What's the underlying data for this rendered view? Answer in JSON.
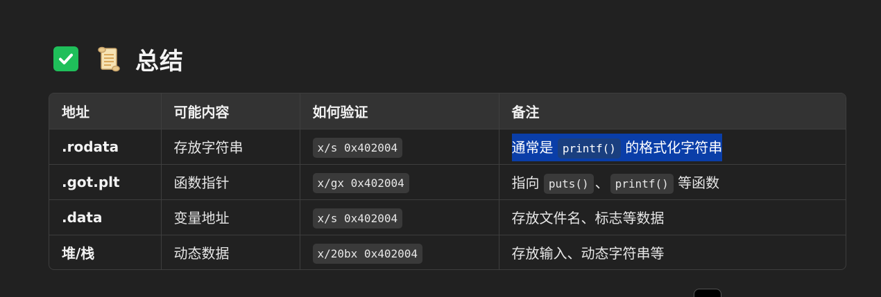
{
  "heading": {
    "title": "总结"
  },
  "table": {
    "headers": [
      "地址",
      "可能内容",
      "如何验证",
      "备注"
    ],
    "rows": [
      {
        "address": ".rodata",
        "content": "存放字符串",
        "verify": "x/s 0x402004",
        "note_pre": "通常是",
        "note_code1": "printf()",
        "note_post": "的格式化字符串"
      },
      {
        "address": ".got.plt",
        "content": "函数指针",
        "verify": "x/gx 0x402004",
        "note_pre": "指向",
        "note_code1": "puts()",
        "note_mid": "、",
        "note_code2": "printf()",
        "note_post": "等函数"
      },
      {
        "address": ".data",
        "content": "变量地址",
        "verify": "x/s 0x402004",
        "note_text": "存放文件名、标志等数据"
      },
      {
        "address": "堆/栈",
        "content": "动态数据",
        "verify": "x/20bx 0x402004",
        "note_text": "存放输入、动态字符串等"
      }
    ]
  },
  "colors": {
    "background": "#212121",
    "header_row": "#333333",
    "highlight": "#0a3ea8",
    "check_green": "#1fbf5a"
  }
}
